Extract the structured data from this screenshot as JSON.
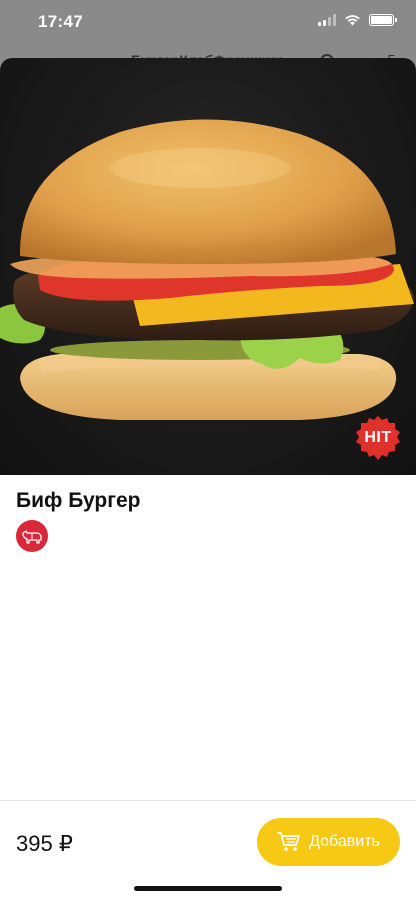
{
  "status_bar": {
    "time": "17:47",
    "signal": "cellular-signal-icon",
    "wifi": "wifi-icon",
    "battery": "battery-icon"
  },
  "underlying_nav": {
    "title": "БургерКлабФраншиза",
    "back_icon": "chevron-left-icon",
    "right_label": "Б"
  },
  "product": {
    "title": "Биф Бургер",
    "badge": "HIT",
    "category_icon": "beef-icon",
    "image": "burger-photo"
  },
  "footer": {
    "price": "395 ₽",
    "add_label": "Добавить",
    "cart_icon": "cart-icon"
  },
  "colors": {
    "accent": "#f7c814",
    "badge": "#e0302b",
    "beef": "#d9283a"
  }
}
